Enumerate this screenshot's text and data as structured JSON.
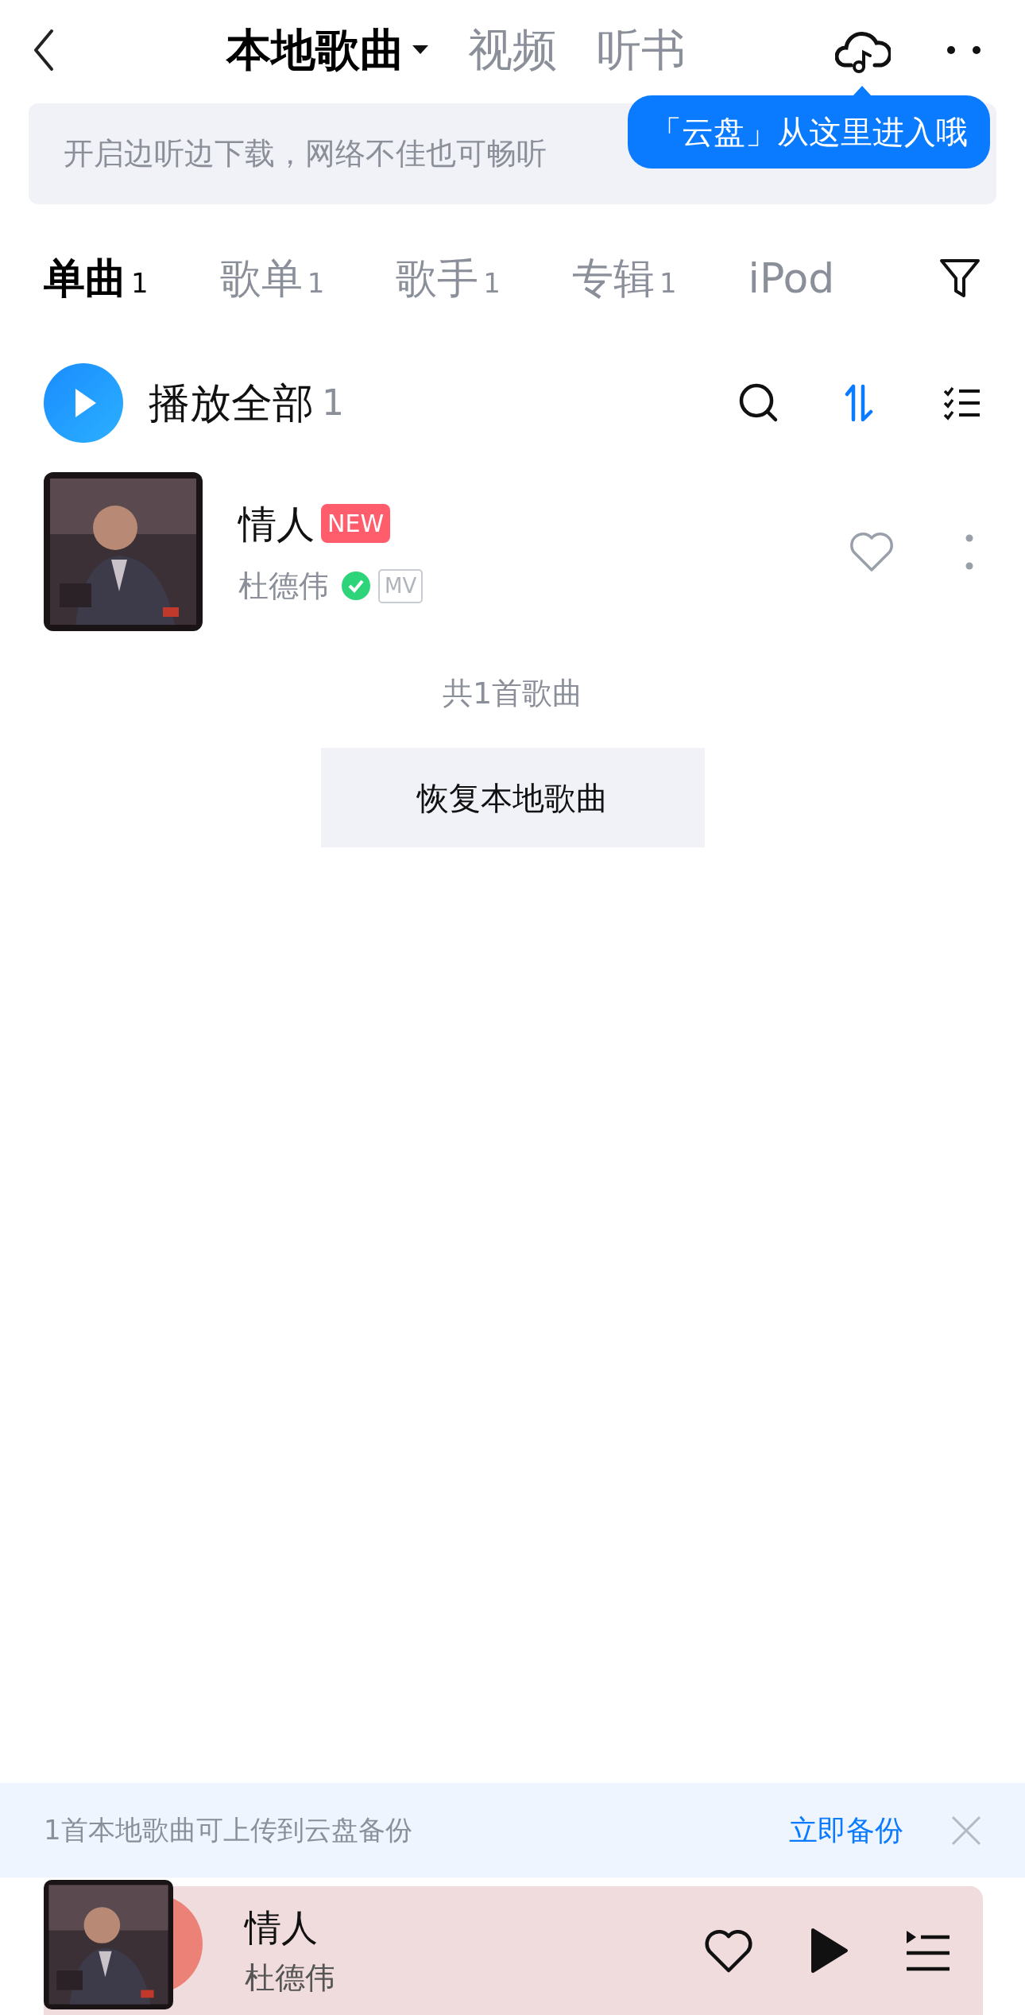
{
  "top_tabs": [
    {
      "label": "本地歌曲",
      "selected": true,
      "dropdown": true
    },
    {
      "label": "视频",
      "selected": false,
      "dropdown": false
    },
    {
      "label": "听书",
      "selected": false,
      "dropdown": false
    }
  ],
  "tooltip": "「云盘」从这里进入哦",
  "banner": {
    "text": "开启边听边下载，网络不佳也可畅听"
  },
  "category_tabs": [
    {
      "label": "单曲",
      "count": "1",
      "selected": true
    },
    {
      "label": "歌单",
      "count": "1",
      "selected": false
    },
    {
      "label": "歌手",
      "count": "1",
      "selected": false
    },
    {
      "label": "专辑",
      "count": "1",
      "selected": false
    },
    {
      "label": "iPod",
      "selected": false
    }
  ],
  "play_all": {
    "label": "播放全部",
    "count": "1"
  },
  "songs": [
    {
      "title": "情人",
      "badge": "NEW",
      "artist": "杜德伟",
      "verified": true,
      "mv": "MV",
      "liked": false
    }
  ],
  "summary": "共1首歌曲",
  "restore_button": "恢复本地歌曲",
  "backup_bar": {
    "text": "1首本地歌曲可上传到云盘备份",
    "action": "立即备份"
  },
  "player": {
    "title": "情人",
    "artist": "杜德伟",
    "playing": false,
    "liked": false
  }
}
